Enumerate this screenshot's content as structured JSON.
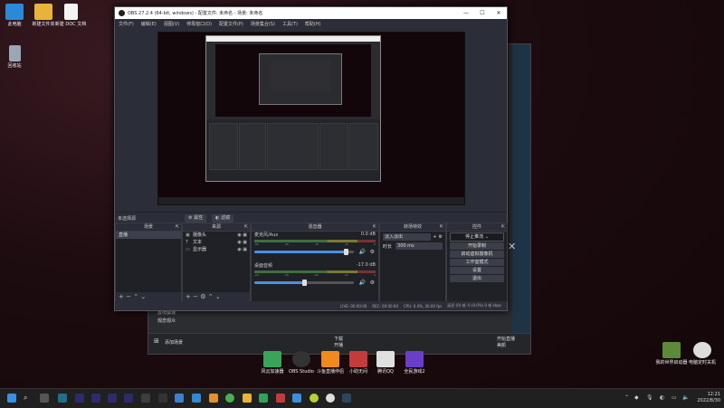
{
  "desktop": {
    "icons": [
      {
        "label": "此电脑"
      },
      {
        "label": "新建文件夹"
      },
      {
        "label": "新建 DOC 文档"
      },
      {
        "label": "回收站"
      }
    ],
    "shortcuts": [
      {
        "label": "风云加速器"
      },
      {
        "label": "OBS Studio"
      },
      {
        "label": "斗鱼直播伴侣"
      },
      {
        "label": "小助无间"
      },
      {
        "label": "腾讯QQ"
      },
      {
        "label": "全民游戏2"
      }
    ],
    "right_icons": [
      {
        "label": "我的世界启动器"
      },
      {
        "label": "电脑定时关机"
      }
    ]
  },
  "bg_window": {
    "list": [
      "皮喷像误",
      "观念观众"
    ],
    "add_scene": "添加场景",
    "bottom_mid": "下载",
    "bottom_mid2": "开播",
    "bottom_right": "开始直播",
    "bottom_right2": "美颜"
  },
  "obs": {
    "title": "OBS 27.2.4 (64-bit, windows) - 配置文件: 未命名 - 场景: 未命名",
    "menu": [
      "文件(F)",
      "编辑(E)",
      "视图(V)",
      "停靠窗口(D)",
      "配置文件(P)",
      "场景集合(S)",
      "工具(T)",
      "帮助(H)"
    ],
    "source_bar": {
      "label": "未选择源",
      "props": "属性",
      "filters": "滤镜"
    },
    "docks": {
      "scenes": {
        "title": "场景",
        "items": [
          "直播"
        ]
      },
      "sources": {
        "title": "来源",
        "items": [
          {
            "icon": "▣",
            "label": "摄像头"
          },
          {
            "icon": "T",
            "label": "文本"
          },
          {
            "icon": "▭",
            "label": "显示器"
          }
        ]
      },
      "mixer": {
        "title": "混音器",
        "channels": [
          {
            "name": "麦克风/Aux",
            "db": "0.0 dB",
            "level": 0.92
          },
          {
            "name": "桌面音频",
            "db": "-17.0 dB",
            "level": 0.5
          }
        ]
      },
      "transitions": {
        "title": "转场特效",
        "type": "淡入淡出",
        "duration_label": "时长",
        "duration": "300 ms"
      },
      "controls": {
        "title": "控件",
        "buttons": [
          "停止推流",
          "开始录制",
          "启动虚拟摄像机",
          "工作室模式",
          "设置",
          "退出"
        ]
      }
    },
    "status": {
      "live": "LIVE: 00:00:00",
      "rec": "REC: 00:00:00",
      "cpu": "CPU: 0.4%, 30.00 fps",
      "dropped": "延迟 (0) 帧: 0 (0.0%)  0 帧 kbps"
    }
  },
  "taskbar": {
    "time": "12:21",
    "date": "2022/8/30"
  },
  "colors": {
    "obs_bg": "#2b2e38",
    "accent_blue": "#4a90e2"
  }
}
